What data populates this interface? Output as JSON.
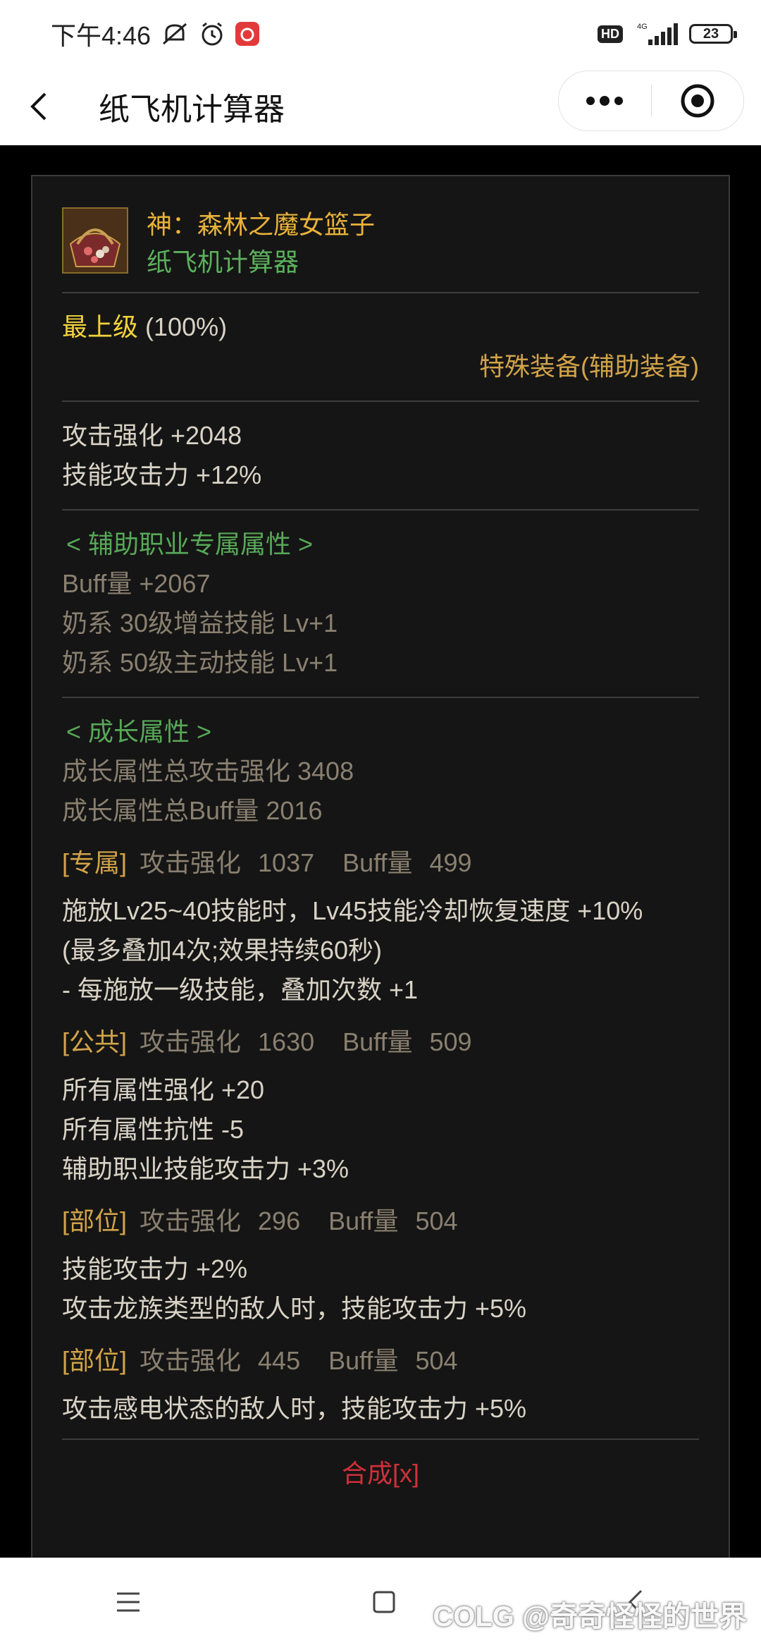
{
  "status_bar": {
    "time": "下午4:46",
    "hd": "HD",
    "net": "4G",
    "battery": "23"
  },
  "titlebar": {
    "title": "纸飞机计算器"
  },
  "item": {
    "name": "神：森林之魔女篮子",
    "subtitle": "纸飞机计算器",
    "grade": "最上级",
    "grade_pct": "(100%)",
    "type": "特殊装备(辅助装备)",
    "base_stats": [
      "攻击强化 +2048",
      "技能攻击力 +12%"
    ],
    "support_section": {
      "title": "< 辅助职业专属属性 >",
      "lines": [
        "Buff量 +2067",
        "奶系 30级增益技能 Lv+1",
        "奶系 50级主动技能 Lv+1"
      ]
    },
    "growth_section": {
      "title": "< 成长属性 >",
      "lines": [
        "成长属性总攻击强化 3408",
        "成长属性总Buff量 2016"
      ]
    },
    "growth_entries": [
      {
        "tag": "[专属]",
        "atk_label": "攻击强化",
        "atk": "1037",
        "buff_label": "Buff量",
        "buff": "499",
        "lines": [
          "施放Lv25~40技能时，Lv45技能冷却恢复速度 +10%",
          "(最多叠加4次;效果持续60秒)",
          "- 每施放一级技能，叠加次数 +1"
        ]
      },
      {
        "tag": "[公共]",
        "atk_label": "攻击强化",
        "atk": "1630",
        "buff_label": "Buff量",
        "buff": "509",
        "lines": [
          "所有属性强化 +20",
          "所有属性抗性 -5",
          "辅助职业技能攻击力 +3%"
        ]
      },
      {
        "tag": "[部位]",
        "atk_label": "攻击强化",
        "atk": "296",
        "buff_label": "Buff量",
        "buff": "504",
        "lines": [
          "技能攻击力 +2%",
          "攻击龙族类型的敌人时，技能攻击力 +5%"
        ]
      },
      {
        "tag": "[部位]",
        "atk_label": "攻击强化",
        "atk": "445",
        "buff_label": "Buff量",
        "buff": "504",
        "lines": [
          "攻击感电状态的敌人时，技能攻击力 +5%"
        ]
      }
    ],
    "synthesis": "合成[x]"
  },
  "watermark": "COLG @奇奇怪怪的世界",
  "colors": {
    "gold": "#e9b23a",
    "green": "#57a857",
    "yellow": "#f2d23b",
    "red": "#d0303a",
    "panel": "#151515"
  }
}
